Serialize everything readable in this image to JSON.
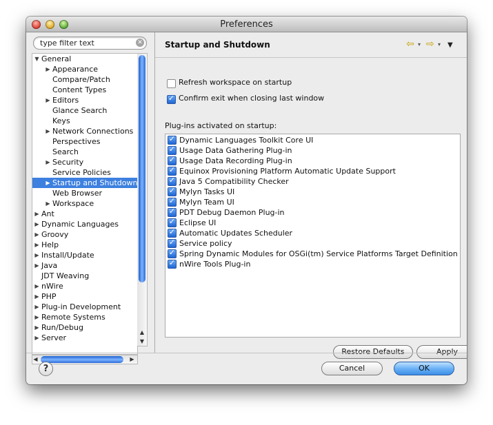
{
  "window": {
    "title": "Preferences"
  },
  "filter": {
    "placeholder": "type filter text"
  },
  "tree": [
    {
      "label": "General",
      "expanded": true,
      "level": 0,
      "has_children": true
    },
    {
      "label": "Appearance",
      "level": 1,
      "has_children": true
    },
    {
      "label": "Compare/Patch",
      "level": 1
    },
    {
      "label": "Content Types",
      "level": 1
    },
    {
      "label": "Editors",
      "level": 1,
      "has_children": true
    },
    {
      "label": "Glance Search",
      "level": 1
    },
    {
      "label": "Keys",
      "level": 1
    },
    {
      "label": "Network Connections",
      "level": 1,
      "has_children": true
    },
    {
      "label": "Perspectives",
      "level": 1
    },
    {
      "label": "Search",
      "level": 1
    },
    {
      "label": "Security",
      "level": 1,
      "has_children": true
    },
    {
      "label": "Service Policies",
      "level": 1
    },
    {
      "label": "Startup and Shutdown",
      "level": 1,
      "has_children": true,
      "selected": true
    },
    {
      "label": "Web Browser",
      "level": 1
    },
    {
      "label": "Workspace",
      "level": 1,
      "has_children": true
    },
    {
      "label": "Ant",
      "level": 0,
      "has_children": true
    },
    {
      "label": "Dynamic Languages",
      "level": 0,
      "has_children": true
    },
    {
      "label": "Groovy",
      "level": 0,
      "has_children": true
    },
    {
      "label": "Help",
      "level": 0,
      "has_children": true
    },
    {
      "label": "Install/Update",
      "level": 0,
      "has_children": true
    },
    {
      "label": "Java",
      "level": 0,
      "has_children": true
    },
    {
      "label": "JDT Weaving",
      "level": 0
    },
    {
      "label": "nWire",
      "level": 0,
      "has_children": true
    },
    {
      "label": "PHP",
      "level": 0,
      "has_children": true
    },
    {
      "label": "Plug-in Development",
      "level": 0,
      "has_children": true
    },
    {
      "label": "Remote Systems",
      "level": 0,
      "has_children": true
    },
    {
      "label": "Run/Debug",
      "level": 0,
      "has_children": true
    },
    {
      "label": "Server",
      "level": 0,
      "has_children": true
    }
  ],
  "page": {
    "title": "Startup and Shutdown",
    "options": [
      {
        "label": "Refresh workspace on startup",
        "checked": false
      },
      {
        "label": "Confirm exit when closing last window",
        "checked": true
      }
    ],
    "plugins_label": "Plug-ins activated on startup:",
    "plugins": [
      {
        "label": "Dynamic Languages Toolkit Core UI",
        "checked": true
      },
      {
        "label": "Usage Data Gathering Plug-in",
        "checked": true
      },
      {
        "label": "Usage Data Recording Plug-in",
        "checked": true
      },
      {
        "label": "Equinox Provisioning Platform Automatic Update Support",
        "checked": true
      },
      {
        "label": "Java 5 Compatibility Checker",
        "checked": true
      },
      {
        "label": "Mylyn Tasks UI",
        "checked": true
      },
      {
        "label": "Mylyn Team UI",
        "checked": true
      },
      {
        "label": "PDT Debug Daemon Plug-in",
        "checked": true
      },
      {
        "label": "Eclipse UI",
        "checked": true
      },
      {
        "label": "Automatic Updates Scheduler",
        "checked": true
      },
      {
        "label": "Service policy",
        "checked": true
      },
      {
        "label": "Spring Dynamic Modules for OSGi(tm) Service Platforms Target Definition",
        "checked": true
      },
      {
        "label": "nWire Tools Plug-in",
        "checked": true
      }
    ],
    "restore_defaults": "Restore Defaults",
    "apply": "Apply"
  },
  "footer": {
    "help": "?",
    "cancel": "Cancel",
    "ok": "OK"
  },
  "icons": {
    "back": "back-arrow-icon",
    "forward": "forward-arrow-icon",
    "menu": "view-menu-icon",
    "help": "help-icon",
    "clear": "clear-search-icon"
  },
  "colors": {
    "selection": "#3d80df",
    "default_button": "#6cb2f6",
    "scroll_thumb": "#2a6ad8"
  }
}
